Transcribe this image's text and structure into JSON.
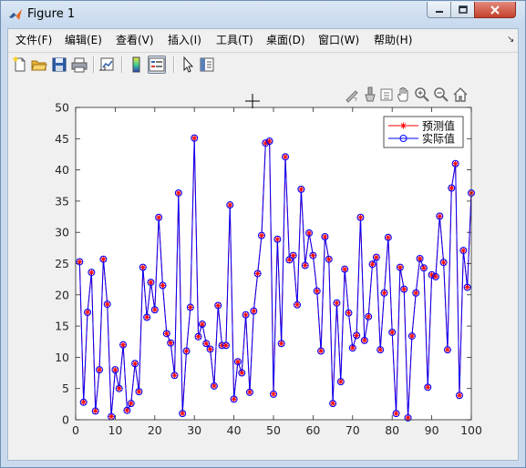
{
  "window": {
    "title": "Figure 1",
    "controls": {
      "minimize_icon": "minimize-icon",
      "maximize_icon": "maximize-icon",
      "close_icon": "close-icon"
    }
  },
  "menu": {
    "items": [
      "文件(F)",
      "编辑(E)",
      "查看(V)",
      "插入(I)",
      "工具(T)",
      "桌面(D)",
      "窗口(W)",
      "帮助(H)"
    ]
  },
  "toolbar": {
    "icons": [
      "new-figure-icon",
      "open-file-icon",
      "save-icon",
      "print-icon",
      "link-plot-icon",
      "colorbar-icon",
      "legend-icon",
      "edit-plot-icon",
      "property-inspector-icon"
    ]
  },
  "axes_toolbar": {
    "icons": [
      "brush-icon",
      "data-tips-icon",
      "insert-icon",
      "pan-icon",
      "zoom-in-icon",
      "zoom-out-icon",
      "home-icon"
    ]
  },
  "colors": {
    "predicted": "#ff0000",
    "actual": "#0000ff",
    "axes_bg": "#ffffff",
    "figure_bg": "#f0f0f0"
  },
  "chart_data": {
    "type": "line",
    "title": "",
    "xlabel": "",
    "ylabel": "",
    "xlim": [
      0,
      100
    ],
    "ylim": [
      0,
      50
    ],
    "xticks": [
      0,
      10,
      20,
      30,
      40,
      50,
      60,
      70,
      80,
      90,
      100
    ],
    "yticks": [
      0,
      5,
      10,
      15,
      20,
      25,
      30,
      35,
      40,
      45,
      50
    ],
    "grid": false,
    "legend_position": "top-right",
    "x": [
      1,
      2,
      3,
      4,
      5,
      6,
      7,
      8,
      9,
      10,
      11,
      12,
      13,
      14,
      15,
      16,
      17,
      18,
      19,
      20,
      21,
      22,
      23,
      24,
      25,
      26,
      27,
      28,
      29,
      30,
      31,
      32,
      33,
      34,
      35,
      36,
      37,
      38,
      39,
      40,
      41,
      42,
      43,
      44,
      45,
      46,
      47,
      48,
      49,
      50,
      51,
      52,
      53,
      54,
      55,
      56,
      57,
      58,
      59,
      60,
      61,
      62,
      63,
      64,
      65,
      66,
      67,
      68,
      69,
      70,
      71,
      72,
      73,
      74,
      75,
      76,
      77,
      78,
      79,
      80,
      81,
      82,
      83,
      84,
      85,
      86,
      87,
      88,
      89,
      90,
      91,
      92,
      93,
      94,
      95,
      96,
      97,
      98,
      99,
      100
    ],
    "series": [
      {
        "name": "预测值",
        "marker": "asterisk",
        "values": [
          25.3,
          2.8,
          17.2,
          23.6,
          1.4,
          8.0,
          25.7,
          18.5,
          0.5,
          8.0,
          5.0,
          12.0,
          1.5,
          2.6,
          9.0,
          4.5,
          24.4,
          16.4,
          22.0,
          17.6,
          32.4,
          21.5,
          13.8,
          12.3,
          7.1,
          36.3,
          1.0,
          11.0,
          18.0,
          45.1,
          13.3,
          15.3,
          12.2,
          11.3,
          5.4,
          18.3,
          11.9,
          11.9,
          34.4,
          3.3,
          9.3,
          7.5,
          16.8,
          4.4,
          17.4,
          23.4,
          29.5,
          44.3,
          44.6,
          4.1,
          28.9,
          12.2,
          42.1,
          25.6,
          26.3,
          18.4,
          36.9,
          24.7,
          29.9,
          26.3,
          20.6,
          11.0,
          29.3,
          25.7,
          2.6,
          18.7,
          6.1,
          24.1,
          17.1,
          11.5,
          13.5,
          32.4,
          12.7,
          16.5,
          24.9,
          26.0,
          11.2,
          20.3,
          29.2,
          14.0,
          1.0,
          24.4,
          20.9,
          0.3,
          13.4,
          20.3,
          25.8,
          24.3,
          5.2,
          23.2,
          22.9,
          32.6,
          25.2,
          11.2,
          37.1,
          41.0,
          3.9,
          27.1,
          21.2,
          36.3
        ]
      },
      {
        "name": "实际值",
        "marker": "circle",
        "values": [
          25.3,
          2.8,
          17.2,
          23.6,
          1.4,
          8.0,
          25.7,
          18.5,
          0.5,
          8.0,
          5.0,
          12.0,
          1.5,
          2.6,
          9.0,
          4.5,
          24.4,
          16.4,
          22.0,
          17.6,
          32.4,
          21.5,
          13.8,
          12.3,
          7.1,
          36.3,
          1.0,
          11.0,
          18.0,
          45.1,
          13.3,
          15.3,
          12.2,
          11.3,
          5.4,
          18.3,
          11.9,
          11.9,
          34.4,
          3.3,
          9.3,
          7.5,
          16.8,
          4.4,
          17.4,
          23.4,
          29.5,
          44.3,
          44.6,
          4.1,
          28.9,
          12.2,
          42.1,
          25.6,
          26.3,
          18.4,
          36.9,
          24.7,
          29.9,
          26.3,
          20.6,
          11.0,
          29.3,
          25.7,
          2.6,
          18.7,
          6.1,
          24.1,
          17.1,
          11.5,
          13.5,
          32.4,
          12.7,
          16.5,
          24.9,
          26.0,
          11.2,
          20.3,
          29.2,
          14.0,
          1.0,
          24.4,
          20.9,
          0.3,
          13.4,
          20.3,
          25.8,
          24.3,
          5.2,
          23.2,
          22.9,
          32.6,
          25.2,
          11.2,
          37.1,
          41.0,
          3.9,
          27.1,
          21.2,
          36.3
        ]
      }
    ]
  }
}
